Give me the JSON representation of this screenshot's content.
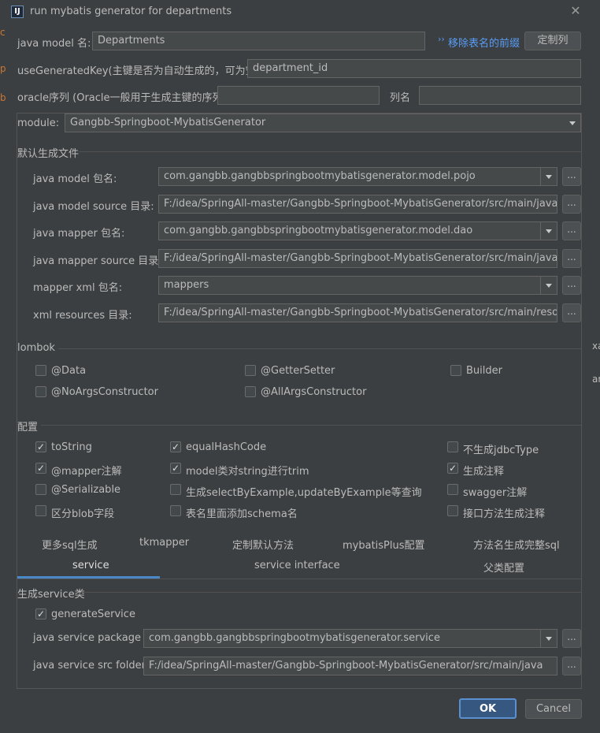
{
  "window": {
    "title": "run mybatis generator for departments",
    "app_icon": "IJ"
  },
  "behind_chars": [
    "c",
    "p",
    "b"
  ],
  "behind_right": [
    "xa",
    "ar"
  ],
  "java_model": {
    "label": "java model 名:",
    "value": "Departments",
    "link": "移除表名的前缀",
    "button": "定制列"
  },
  "use_generated_key": {
    "label": "useGeneratedKey(主键是否为自动生成的，可为空):",
    "value": "department_id"
  },
  "oracle": {
    "label": "oracle序列 (Oracle一般用于生成主键的序列)",
    "value": "",
    "col_label": "列名",
    "col_value": ""
  },
  "module": {
    "label": "module:",
    "value": "Gangbb-Springboot-MybatisGenerator"
  },
  "default_files": {
    "section_title": "默认生成文件",
    "rows": [
      {
        "label": "java model 包名:",
        "value": "com.gangbb.gangbbspringbootmybatisgenerator.model.pojo",
        "combo": true
      },
      {
        "label": "java model source 目录:",
        "value": "F:/idea/SpringAll-master/Gangbb-Springboot-MybatisGenerator/src/main/java",
        "combo": false
      },
      {
        "label": "java mapper 包名:",
        "value": "com.gangbb.gangbbspringbootmybatisgenerator.model.dao",
        "combo": true
      },
      {
        "label": "java mapper source 目录:",
        "value": "F:/idea/SpringAll-master/Gangbb-Springboot-MybatisGenerator/src/main/java",
        "combo": false
      },
      {
        "label": "mapper xml 包名:",
        "value": "mappers",
        "combo": true
      },
      {
        "label": "xml resources 目录:",
        "value": "F:/idea/SpringAll-master/Gangbb-Springboot-MybatisGenerator/src/main/resources",
        "combo": false
      }
    ],
    "browse_label": "..."
  },
  "lombok": {
    "section_title": "lombok",
    "items": [
      {
        "label": "@Data",
        "checked": false
      },
      {
        "label": "@GetterSetter",
        "checked": false
      },
      {
        "label": "Builder",
        "checked": false
      },
      {
        "label": "@NoArgsConstructor",
        "checked": false
      },
      {
        "label": "@AllArgsConstructor",
        "checked": false
      }
    ]
  },
  "config": {
    "section_title": "配置",
    "items": [
      {
        "label": "toString",
        "checked": true
      },
      {
        "label": "equalHashCode",
        "checked": true
      },
      {
        "label": "不生成jdbcType",
        "checked": false
      },
      {
        "label": "@mapper注解",
        "checked": true
      },
      {
        "label": "model类对string进行trim",
        "checked": true
      },
      {
        "label": "生成注释",
        "checked": true
      },
      {
        "label": "@Serializable",
        "checked": false
      },
      {
        "label": "生成selectByExample,updateByExample等查询",
        "checked": false
      },
      {
        "label": "swagger注解",
        "checked": false
      },
      {
        "label": "区分blob字段",
        "checked": false
      },
      {
        "label": "表名里面添加schema名",
        "checked": false
      },
      {
        "label": "接口方法生成注释",
        "checked": false
      }
    ]
  },
  "tabs_row1": [
    "更多sql生成",
    "tkmapper",
    "定制默认方法",
    "mybatisPlus配置",
    "方法名生成完整sql"
  ],
  "tabs_row2": [
    "service",
    "service interface",
    "父类配置"
  ],
  "active_tab": "service",
  "service": {
    "section_title": "生成service类",
    "generate_label": "generateService",
    "generate_checked": true,
    "package_label": "java service package",
    "package_value": "com.gangbb.gangbbspringbootmybatisgenerator.service",
    "folder_label": "java service src folder",
    "folder_value": "F:/idea/SpringAll-master/Gangbb-Springboot-MybatisGenerator/src/main/java"
  },
  "footer": {
    "ok": "OK",
    "cancel": "Cancel"
  },
  "colors": {
    "accent": "#589df6",
    "active_tab_underline": "#4a88c7",
    "ok_border": "#5a8fd0",
    "ok_bg": "#365880"
  }
}
